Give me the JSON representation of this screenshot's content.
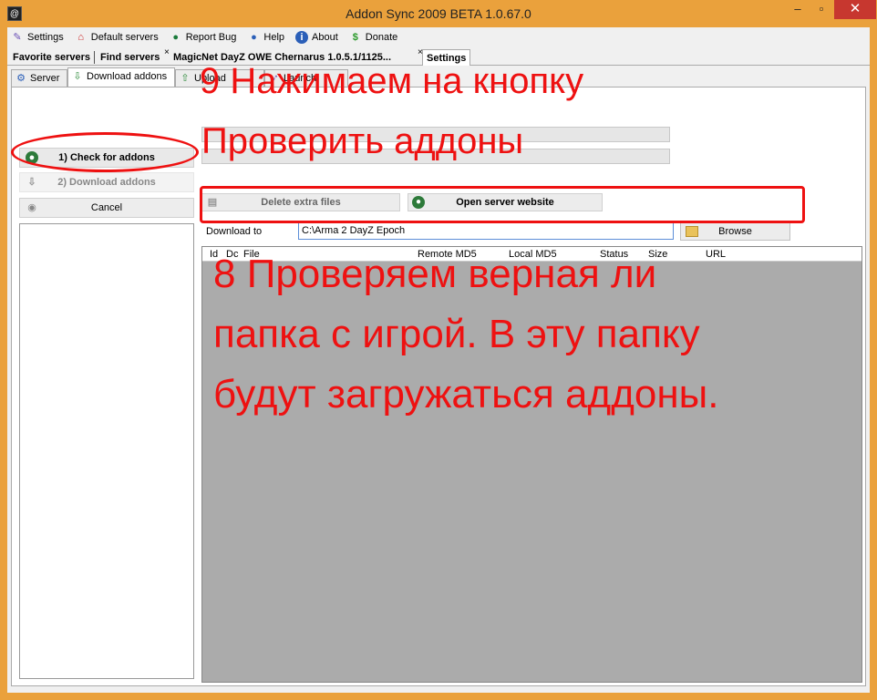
{
  "window": {
    "app_icon": "@",
    "title": "Addon Sync 2009 BETA 1.0.67.0",
    "minimize": "–",
    "maximize": "▫",
    "close": "✕"
  },
  "menu": {
    "items": [
      {
        "label": "Settings",
        "icon": "pencil-icon"
      },
      {
        "label": "Default servers",
        "icon": "house-icon"
      },
      {
        "label": "Report Bug",
        "icon": "globe-icon"
      },
      {
        "label": "Help",
        "icon": "help-icon"
      },
      {
        "label": "About",
        "icon": "info-icon"
      },
      {
        "label": "Donate",
        "icon": "dollar-icon"
      }
    ]
  },
  "top_tabs": {
    "favorite": "Favorite servers",
    "find": "Find servers",
    "server_close": "×",
    "server": "MagicNet DayZ OWE Chernarus 1.0.5.1/1125...",
    "settings_close": "×",
    "settings": "Settings"
  },
  "inner_tabs": {
    "server": "Server",
    "download_addons": "Download addons",
    "upload_addons": "Upload addons",
    "launch_game": "Launch game"
  },
  "side": {
    "check": "1) Check for addons",
    "download": "2) Download addons",
    "cancel": "Cancel"
  },
  "actions": {
    "delete": "Delete extra files",
    "website": "Open server website"
  },
  "download_to": {
    "label": "Download to",
    "value": "C:\\Arma 2 DayZ Epoch",
    "browse": "Browse"
  },
  "grid": {
    "columns": [
      "Id",
      "Dc",
      "File",
      "Remote MD5",
      "Local MD5",
      "Status",
      "Size",
      "URL"
    ]
  },
  "annotations": {
    "step9_line1": "9 Нажимаем на кнопку",
    "step9_line2": "Проверить аддоны",
    "step8_lines": [
      "8 Проверяем верная ли",
      "папка с игрой. В эту папку",
      "будут загружаться аддоны."
    ]
  },
  "colors": {
    "frame": "#eaa13c",
    "annotation": "#ee1111",
    "close_button": "#c7372f",
    "grid_background": "#ababab"
  }
}
